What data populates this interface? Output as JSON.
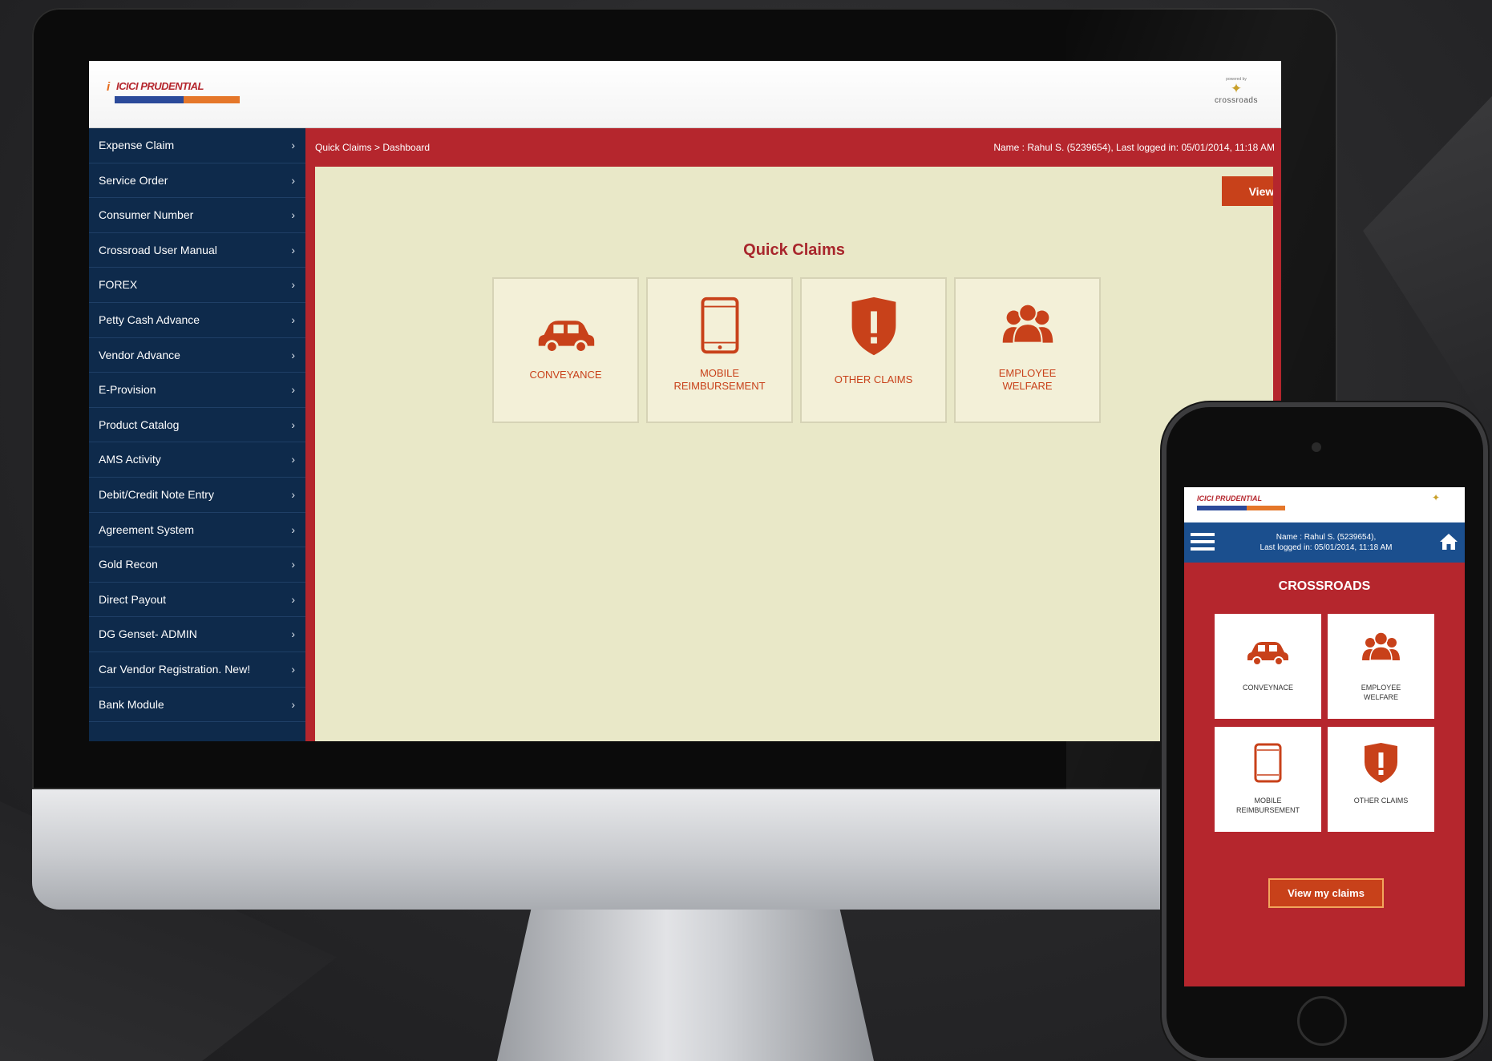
{
  "desktop": {
    "brand": {
      "logo_text": "ICICI PRUDENTIAL",
      "logo_mark": "i"
    },
    "powered_by": {
      "small_text": "powered by",
      "name": "crossroads"
    },
    "sidebar": {
      "items": [
        {
          "label": "Expense Claim"
        },
        {
          "label": "Service Order"
        },
        {
          "label": "Consumer Number"
        },
        {
          "label": "Crossroad User Manual"
        },
        {
          "label": "FOREX"
        },
        {
          "label": "Petty Cash Advance"
        },
        {
          "label": "Vendor Advance"
        },
        {
          "label": "E-Provision"
        },
        {
          "label": "Product Catalog"
        },
        {
          "label": "AMS Activity"
        },
        {
          "label": "Debit/Credit Note Entry"
        },
        {
          "label": "Agreement System"
        },
        {
          "label": "Gold Recon"
        },
        {
          "label": "Direct Payout"
        },
        {
          "label": "DG Genset- ADMIN"
        },
        {
          "label": "Car Vendor Registration. New!"
        },
        {
          "label": "Bank Module"
        }
      ],
      "chevron": "›"
    },
    "breadcrumb": "Quick Claims > Dashboard",
    "user_info": "Name : Rahul S. (5239654), Last logged in: 05/01/2014, 11:18 AM",
    "view_claims_label": "View My Claims",
    "section_title": "Quick Claims",
    "tiles": [
      {
        "label": "CONVEYANCE",
        "icon": "car-icon"
      },
      {
        "label": "MOBILE\nREIMBURSEMENT",
        "icon": "mobile-icon"
      },
      {
        "label": "OTHER CLAIMS",
        "icon": "shield-alert-icon"
      },
      {
        "label": "EMPLOYEE\nWELFARE",
        "icon": "people-icon"
      }
    ]
  },
  "mobile": {
    "brand": {
      "logo_text": "ICICI PRUDENTIAL"
    },
    "user_line1": "Name : Rahul S. (5239654),",
    "user_line2": "Last logged in: 05/01/2014, 11:18 AM",
    "title": "CROSSROADS",
    "tiles": [
      {
        "label": "CONVEYNACE",
        "icon": "car-icon"
      },
      {
        "label": "EMPLOYEE\nWELFARE",
        "icon": "people-icon"
      },
      {
        "label": "MOBILE\nREIMBURSEMENT",
        "icon": "mobile-icon"
      },
      {
        "label": "OTHER CLAIMS",
        "icon": "shield-alert-icon"
      }
    ],
    "view_claims_label": "View my claims"
  },
  "colors": {
    "brand_red": "#b5262d",
    "accent_orange": "#c8411a",
    "sidebar_navy": "#0e2a4b",
    "content_cream": "#e9e8c8",
    "mobile_blue": "#1b4f8e"
  }
}
